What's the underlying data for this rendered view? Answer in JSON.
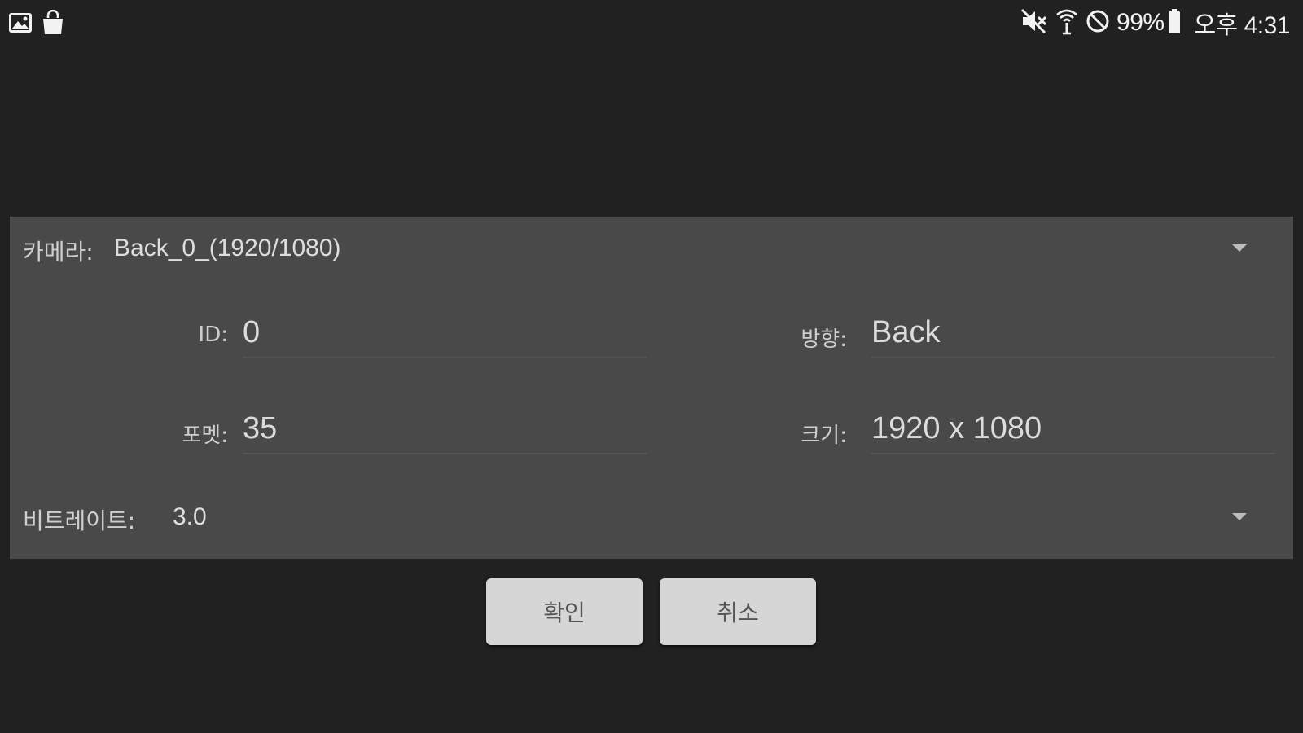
{
  "status_bar": {
    "left_icons": [
      "image-icon",
      "shopping-bag-icon"
    ],
    "right_icons": [
      "mute-icon",
      "wifi-icon",
      "do-not-disturb-icon",
      "battery-icon"
    ],
    "battery_percent": "99%",
    "time": "오후 4:31"
  },
  "dialog": {
    "camera": {
      "label": "카메라:",
      "value": "Back_0_(1920/1080)"
    },
    "fields": {
      "id": {
        "label": "ID:",
        "value": "0"
      },
      "direction": {
        "label": "방향:",
        "value": "Back"
      },
      "format": {
        "label": "포멧:",
        "value": "35"
      },
      "size": {
        "label": "크기:",
        "value": "1920 x 1080"
      }
    },
    "bitrate": {
      "label": "비트레이트:",
      "value": "3.0"
    }
  },
  "buttons": {
    "confirm": "확인",
    "cancel": "취소"
  },
  "colors": {
    "background": "#212121",
    "panel": "#494949",
    "button": "#d6d6d6",
    "button_text": "#555555"
  }
}
